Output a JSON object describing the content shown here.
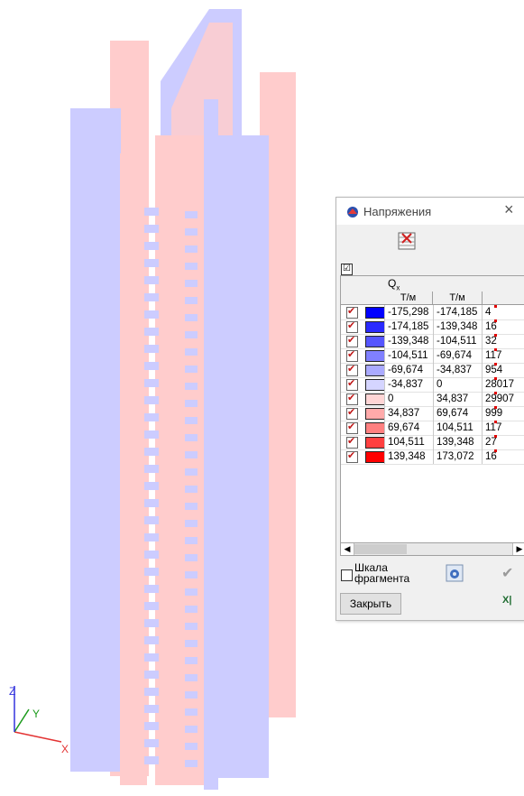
{
  "axes": {
    "x": "X",
    "y": "Y",
    "z": "Z"
  },
  "colors": {
    "pink": "#ffcccc",
    "lavender": "#ccccff",
    "axis_x": "#e33333",
    "axis_y": "#1a9a1a",
    "axis_z": "#3333dd"
  },
  "dialog": {
    "title": "Напряжения",
    "icons": {
      "app": "app-icon",
      "close": "close-icon",
      "toolbar": "table-icon",
      "settings": "settings-icon",
      "apply": "checkmark-icon",
      "excel": "excel-export-icon"
    },
    "close_glyph": "×",
    "select_all": "☑",
    "column_group": "Q",
    "column_group_sub": "x",
    "unit_from": "Т/м",
    "unit_to": "Т/м",
    "rows": [
      {
        "from": "-175,298",
        "to": "-174,185",
        "count": "4",
        "color": "#0000ff"
      },
      {
        "from": "-174,185",
        "to": "-139,348",
        "count": "16",
        "color": "#2a2aff"
      },
      {
        "from": "-139,348",
        "to": "-104,511",
        "count": "32",
        "color": "#5555ff"
      },
      {
        "from": "-104,511",
        "to": "-69,674",
        "count": "117",
        "color": "#8080ff"
      },
      {
        "from": "-69,674",
        "to": "-34,837",
        "count": "954",
        "color": "#aaaaff"
      },
      {
        "from": "-34,837",
        "to": "0",
        "count": "28017",
        "color": "#d5d5ff"
      },
      {
        "from": "0",
        "to": "34,837",
        "count": "29907",
        "color": "#ffd5d5"
      },
      {
        "from": "34,837",
        "to": "69,674",
        "count": "999",
        "color": "#ffaaaa"
      },
      {
        "from": "69,674",
        "to": "104,511",
        "count": "117",
        "color": "#ff8080"
      },
      {
        "from": "104,511",
        "to": "139,348",
        "count": "27",
        "color": "#ff4040"
      },
      {
        "from": "139,348",
        "to": "173,072",
        "count": "16",
        "color": "#ff0000"
      }
    ],
    "fragment_scale_label": "Шкала фрагмента",
    "close_button": "Закрыть"
  }
}
